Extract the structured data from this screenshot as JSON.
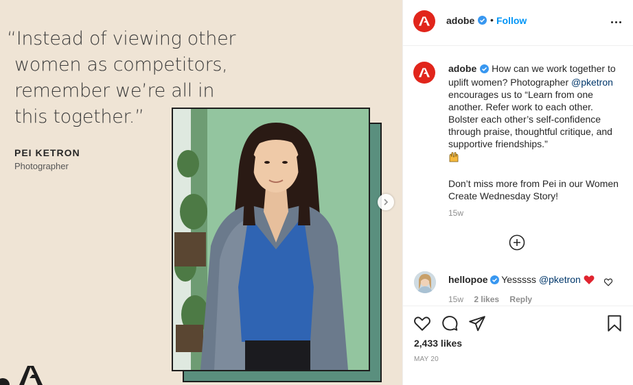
{
  "post_image": {
    "quote_lines": [
      "“Instead of viewing other",
      "women as competitors,",
      "remember we’re all in",
      "this together.”"
    ],
    "author_name": "PEI KETRON",
    "author_role": "Photographer"
  },
  "header": {
    "username": "adobe",
    "separator": "•",
    "follow_label": "Follow",
    "more_icon": "more-options-icon"
  },
  "caption": {
    "username": "adobe",
    "text_1": "How can we work together to uplift women? Photographer",
    "mention": "@pketron",
    "text_2": "encourages us to “Learn from one another. Refer work to each other. Bolster each other’s self-confidence through praise, thoughtful critique, and supportive friendships.”",
    "emoji": "raising-hands-emoji",
    "text_3": "Don’t miss more from Pei in our Women Create Wednesday Story!",
    "time": "15w"
  },
  "load_more_icon": "plus-circle-icon",
  "reply": {
    "username": "hellopoe",
    "text": "Yesssss",
    "mention": "@pketron",
    "emoji": "red-heart-emoji",
    "time": "15w",
    "likes": "2 likes",
    "reply_label": "Reply"
  },
  "actions": {
    "likes": "2,433 likes",
    "date": "MAY 20"
  },
  "colors": {
    "brand_red": "#e1251b",
    "link_blue": "#0095f6",
    "verified_blue": "#3897f0",
    "mention_blue": "#00376b",
    "panel_beige": "#efe4d5",
    "photo_green": "#8fc29b",
    "frame_green": "#5a8f7e"
  }
}
